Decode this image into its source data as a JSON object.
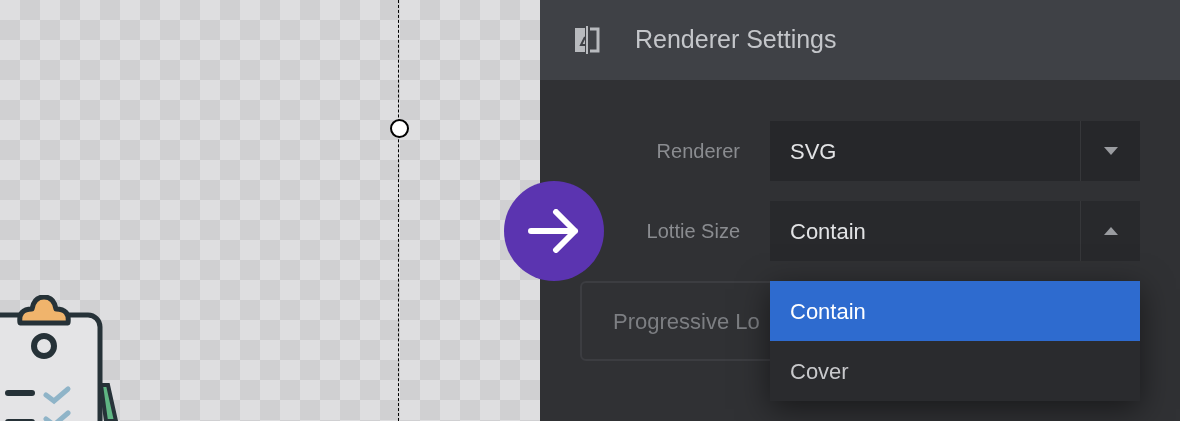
{
  "header": {
    "title": "Renderer Settings"
  },
  "fields": [
    {
      "label": "Renderer",
      "value": "SVG",
      "expanded": false
    },
    {
      "label": "Lottie Size",
      "value": "Contain",
      "expanded": true
    }
  ],
  "progressive_button": {
    "label": "Progressive Lo"
  },
  "dropdown": {
    "options": [
      {
        "label": "Contain",
        "selected": true
      },
      {
        "label": "Cover",
        "selected": false
      }
    ]
  }
}
